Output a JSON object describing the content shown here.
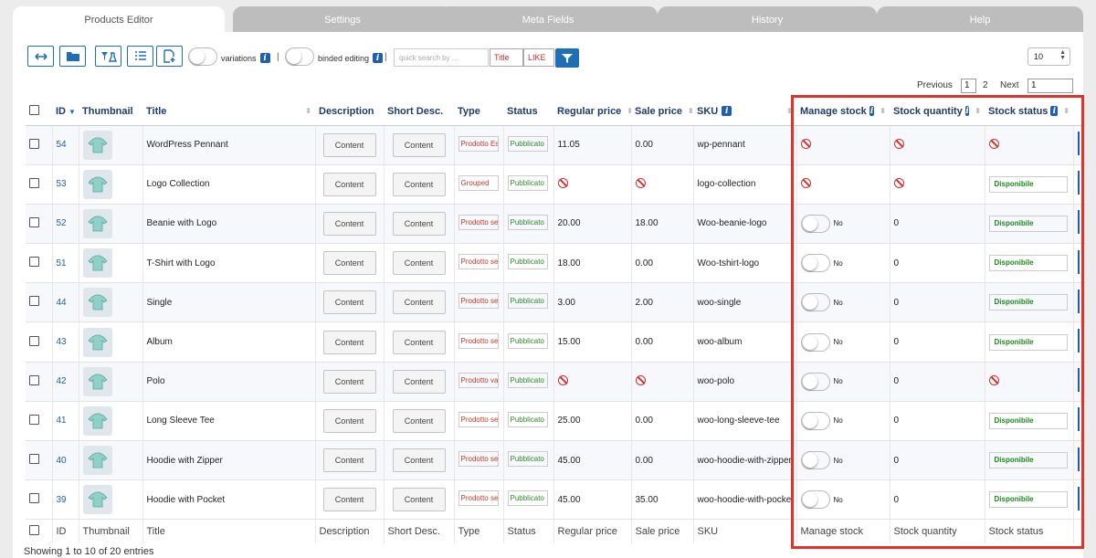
{
  "tabs": [
    {
      "label": "Products Editor",
      "active": true
    },
    {
      "label": "Settings",
      "active": false
    },
    {
      "label": "Meta Fields",
      "active": false
    },
    {
      "label": "History",
      "active": false
    },
    {
      "label": "Help",
      "active": false
    }
  ],
  "toolbar": {
    "icons": [
      "resize-icon",
      "folder-icon",
      "bulk-edit-icon",
      "list-icon",
      "add-product-icon"
    ],
    "variations_label": "variations",
    "binded_label": "binded editing",
    "separator": "|",
    "search_placeholder": "quick search by ...",
    "field_value": "Title",
    "operator_value": "LIKE",
    "per_page": "10"
  },
  "pagination": {
    "previous": "Previous",
    "pages": [
      "1",
      "2"
    ],
    "next": "Next",
    "goto": "1"
  },
  "columns": {
    "id": "ID",
    "thumbnail": "Thumbnail",
    "title": "Title",
    "description": "Description",
    "short_desc": "Short Desc.",
    "type": "Type",
    "status": "Status",
    "regular_price": "Regular price",
    "sale_price": "Sale price",
    "sku": "SKU",
    "manage_stock": "Manage stock",
    "stock_quantity": "Stock quantity",
    "stock_status": "Stock status"
  },
  "content_label": "Content",
  "toggle_no": "No",
  "rows": [
    {
      "id": "54",
      "title": "WordPress Pennant",
      "type": "Prodotto Esterno",
      "status": "Pubblicato",
      "regular": "11.05",
      "sale": "0.00",
      "sku": "wp-pennant",
      "manage": "ban",
      "qty": "ban",
      "stock": "ban"
    },
    {
      "id": "53",
      "title": "Logo Collection",
      "type": "Grouped",
      "status": "Pubblicato",
      "regular": "ban",
      "sale": "ban",
      "sku": "logo-collection",
      "manage": "ban",
      "qty": "ban",
      "stock": "Disponibile"
    },
    {
      "id": "52",
      "title": "Beanie with Logo",
      "type": "Prodotto semplice",
      "status": "Pubblicato",
      "regular": "20.00",
      "sale": "18.00",
      "sku": "Woo-beanie-logo",
      "manage": "toggle",
      "qty": "0",
      "stock": "Disponibile"
    },
    {
      "id": "51",
      "title": "T-Shirt with Logo",
      "type": "Prodotto semplice",
      "status": "Pubblicato",
      "regular": "18.00",
      "sale": "0.00",
      "sku": "Woo-tshirt-logo",
      "manage": "toggle",
      "qty": "0",
      "stock": "Disponibile"
    },
    {
      "id": "44",
      "title": "Single",
      "type": "Prodotto semplice",
      "status": "Pubblicato",
      "regular": "3.00",
      "sale": "2.00",
      "sku": "woo-single",
      "manage": "toggle",
      "qty": "0",
      "stock": "Disponibile"
    },
    {
      "id": "43",
      "title": "Album",
      "type": "Prodotto semplice",
      "status": "Pubblicato",
      "regular": "15.00",
      "sale": "0.00",
      "sku": "woo-album",
      "manage": "toggle",
      "qty": "0",
      "stock": "Disponibile"
    },
    {
      "id": "42",
      "title": "Polo",
      "type": "Prodotto variabile",
      "status": "Pubblicato",
      "regular": "ban",
      "sale": "ban",
      "sku": "woo-polo",
      "manage": "toggle",
      "qty": "0",
      "stock": "ban"
    },
    {
      "id": "41",
      "title": "Long Sleeve Tee",
      "type": "Prodotto semplice",
      "status": "Pubblicato",
      "regular": "25.00",
      "sale": "0.00",
      "sku": "woo-long-sleeve-tee",
      "manage": "toggle",
      "qty": "0",
      "stock": "Disponibile"
    },
    {
      "id": "40",
      "title": "Hoodie with Zipper",
      "type": "Prodotto semplice",
      "status": "Pubblicato",
      "regular": "45.00",
      "sale": "0.00",
      "sku": "woo-hoodie-with-zipper",
      "manage": "toggle",
      "qty": "0",
      "stock": "Disponibile"
    },
    {
      "id": "39",
      "title": "Hoodie with Pocket",
      "type": "Prodotto semplice",
      "status": "Pubblicato",
      "regular": "45.00",
      "sale": "35.00",
      "sku": "woo-hoodie-with-pocket",
      "manage": "toggle",
      "qty": "0",
      "stock": "Disponibile"
    }
  ],
  "footer": {
    "showing": "Showing 1 to 10 of 20 entries"
  },
  "colors": {
    "accent": "#1e6fb5",
    "highlight": "#e0332c",
    "available": "#1a8a1a"
  }
}
